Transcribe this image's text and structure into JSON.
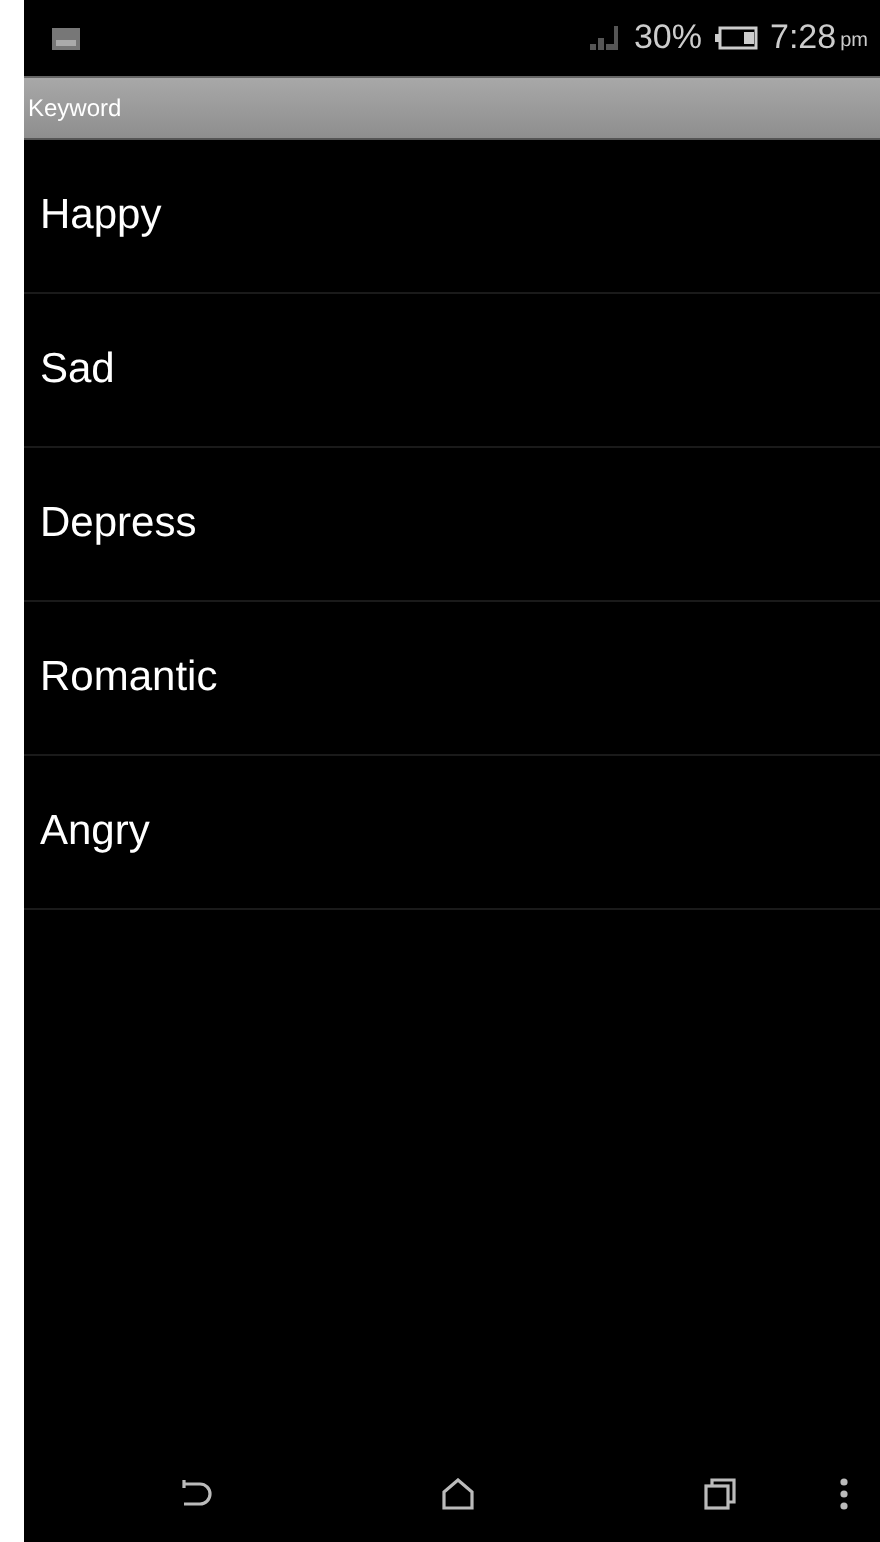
{
  "status_bar": {
    "battery_percent": "30%",
    "time": "7:28",
    "time_suffix": "pm"
  },
  "title_bar": {
    "title": "Keyword"
  },
  "keywords": [
    {
      "label": "Happy"
    },
    {
      "label": "Sad"
    },
    {
      "label": "Depress"
    },
    {
      "label": "Romantic"
    },
    {
      "label": "Angry"
    }
  ]
}
